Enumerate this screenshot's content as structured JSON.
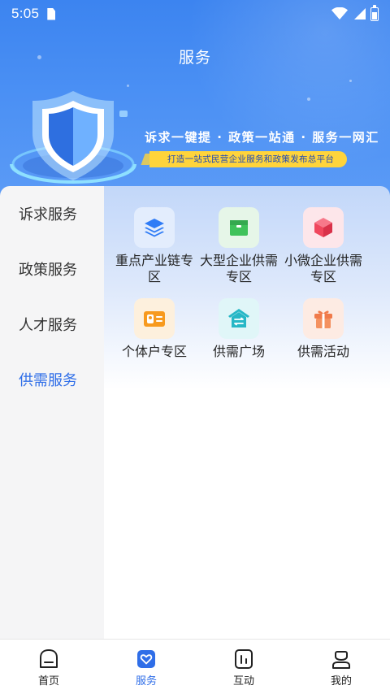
{
  "status_bar": {
    "time": "5:05"
  },
  "header": {
    "title": "服务",
    "slogan": "诉求一键提 · 政策一站通 · 服务一网汇",
    "subtitle": "打造一站式民营企业服务和政策发布总平台"
  },
  "sidebar": {
    "items": [
      {
        "label": "诉求服务",
        "active": false
      },
      {
        "label": "政策服务",
        "active": false
      },
      {
        "label": "人才服务",
        "active": false
      },
      {
        "label": "供需服务",
        "active": true
      }
    ]
  },
  "services": [
    {
      "label": "重点产业链专区",
      "icon": "layers-icon",
      "color": "#2f7cf6",
      "bg": "#e3edfd"
    },
    {
      "label": "大型企业供需专区",
      "icon": "box-icon",
      "color": "#3fc25a",
      "bg": "#e6f6e8"
    },
    {
      "label": "小微企业供需专区",
      "icon": "cube-icon",
      "color": "#f0475d",
      "bg": "#fde6ea"
    },
    {
      "label": "个体户专区",
      "icon": "id-card-icon",
      "color": "#f79a1e",
      "bg": "#fdf0dd"
    },
    {
      "label": "供需广场",
      "icon": "exchange-house-icon",
      "color": "#26b7c6",
      "bg": "#e0f6f8"
    },
    {
      "label": "供需活动",
      "icon": "gift-icon",
      "color": "#f07a4a",
      "bg": "#fdebe3"
    }
  ],
  "bottom_nav": [
    {
      "label": "首页",
      "icon": "home-icon",
      "active": false
    },
    {
      "label": "服务",
      "icon": "service-heart-icon",
      "active": true
    },
    {
      "label": "互动",
      "icon": "interaction-icon",
      "active": false
    },
    {
      "label": "我的",
      "icon": "profile-icon",
      "active": false
    }
  ],
  "colors": {
    "primary": "#2f6ee8",
    "header": "#3c84f0",
    "accent_yellow": "#ffd43b"
  }
}
